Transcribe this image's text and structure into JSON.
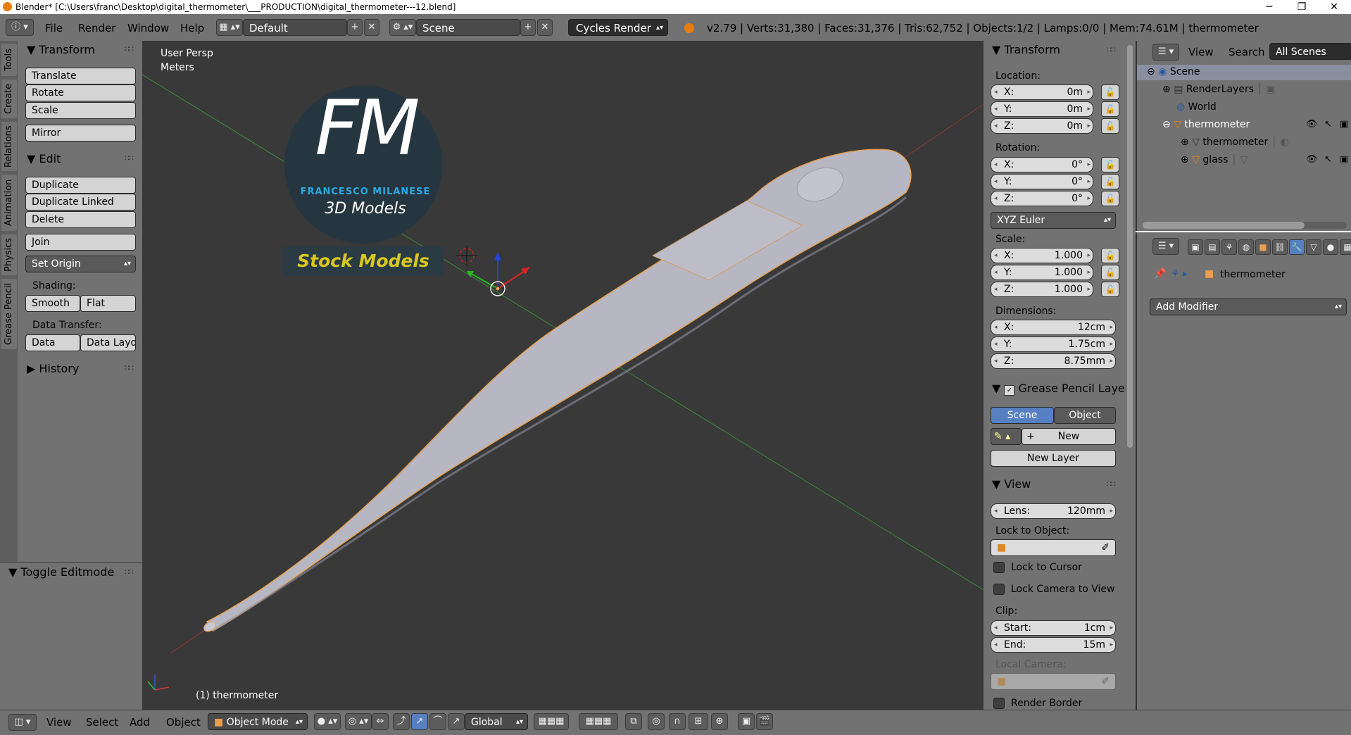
{
  "window": {
    "title": "Blender* [C:\\Users\\franc\\Desktop\\digital_thermometer\\___PRODUCTION\\digital_thermometer---12.blend]",
    "minimize": "─",
    "maximize": "❐",
    "close": "✕"
  },
  "topbar": {
    "info_icon": "ⓘ",
    "menus": [
      "File",
      "Render",
      "Window",
      "Help"
    ],
    "layout": "Default",
    "scene": "Scene",
    "engine": "Cycles Render",
    "stats": "v2.79 | Verts:31,380 | Faces:31,376 | Tris:62,752 | Objects:1/2 | Lamps:0/0 | Mem:74.61M | thermometer"
  },
  "toolshelf": {
    "tabs": [
      "Tools",
      "Create",
      "Relations",
      "Animation",
      "Physics",
      "Grease Pencil"
    ],
    "transform_header": "Transform",
    "transform_buttons": [
      "Translate",
      "Rotate",
      "Scale"
    ],
    "mirror": "Mirror",
    "edit_header": "Edit",
    "edit_buttons": [
      "Duplicate",
      "Duplicate Linked",
      "Delete"
    ],
    "join": "Join",
    "set_origin": "Set Origin",
    "shading_label": "Shading:",
    "smooth": "Smooth",
    "flat": "Flat",
    "data_transfer_label": "Data Transfer:",
    "data": "Data",
    "data_layout": "Data Layo",
    "history": "History",
    "toggle_editmode": "Toggle Editmode"
  },
  "viewport": {
    "view_name": "User Persp",
    "units": "Meters",
    "object_label": "(1) thermometer",
    "logo_letters": "FM",
    "logo_name": "FRANCESCO MILANESE",
    "logo_sub": "3D Models",
    "logo_banner": "Stock Models"
  },
  "npanel": {
    "transform_header": "Transform",
    "location_label": "Location:",
    "location": [
      {
        "k": "X:",
        "v": "0m"
      },
      {
        "k": "Y:",
        "v": "0m"
      },
      {
        "k": "Z:",
        "v": "0m"
      }
    ],
    "rotation_label": "Rotation:",
    "rotation": [
      {
        "k": "X:",
        "v": "0°"
      },
      {
        "k": "Y:",
        "v": "0°"
      },
      {
        "k": "Z:",
        "v": "0°"
      }
    ],
    "rotation_mode": "XYZ Euler",
    "scale_label": "Scale:",
    "scale": [
      {
        "k": "X:",
        "v": "1.000"
      },
      {
        "k": "Y:",
        "v": "1.000"
      },
      {
        "k": "Z:",
        "v": "1.000"
      }
    ],
    "dimensions_label": "Dimensions:",
    "dimensions": [
      {
        "k": "X:",
        "v": "12cm"
      },
      {
        "k": "Y:",
        "v": "1.75cm"
      },
      {
        "k": "Z:",
        "v": "8.75mm"
      }
    ],
    "grease_header": "Grease Pencil Layer",
    "scene_tab": "Scene",
    "object_tab": "Object",
    "new": "New",
    "new_layer": "New Layer",
    "view_header": "View",
    "lens_label": "Lens:",
    "lens_value": "120mm",
    "lock_object_label": "Lock to Object:",
    "lock_cursor": "Lock to Cursor",
    "lock_camera": "Lock Camera to View",
    "clip_label": "Clip:",
    "clip_start_label": "Start:",
    "clip_start": "1cm",
    "clip_end_label": "End:",
    "clip_end": "15m",
    "local_camera_label": "Local Camera:",
    "render_border": "Render Border"
  },
  "outliner": {
    "view": "View",
    "search": "Search",
    "filter": "All Scenes",
    "items": [
      "Scene",
      "RenderLayers",
      "World",
      "thermometer",
      "thermometer",
      "glass"
    ]
  },
  "properties": {
    "object_name": "thermometer",
    "add_modifier": "Add Modifier"
  },
  "bottombar": {
    "menus": [
      "View",
      "Select",
      "Add",
      "Object"
    ],
    "mode": "Object Mode",
    "orientation": "Global"
  },
  "colors": {
    "panel": "#727272",
    "viewport": "#393939",
    "accent_blue": "#5680c2",
    "object_outline": "#e8a050",
    "logo_yellow": "#d8c81c",
    "logo_blue": "#2aa9e0"
  }
}
